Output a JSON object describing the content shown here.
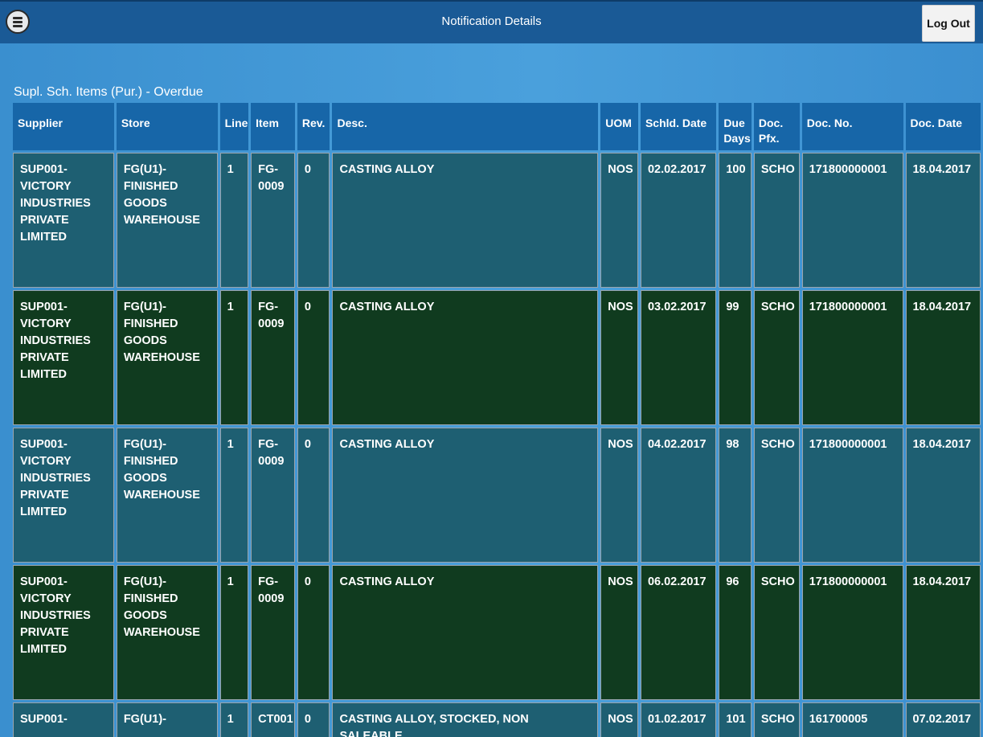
{
  "header": {
    "title": "Notification Details",
    "logout_label": "Log Out",
    "menu_icon": "menu-icon"
  },
  "section": {
    "title": "Supl. Sch. Items (Pur.) - Overdue"
  },
  "table": {
    "columns": [
      "Supplier",
      "Store",
      "Line",
      "Item",
      "Rev.",
      "Desc.",
      "UOM",
      "Schld. Date",
      "Due Days",
      "Doc. Pfx.",
      "Doc. No.",
      "Doc. Date"
    ],
    "rows": [
      [
        "SUP001-VICTORY INDUSTRIES PRIVATE LIMITED",
        "FG(U1)-FINISHED GOODS WAREHOUSE",
        "1",
        "FG-0009",
        "0",
        "CASTING ALLOY",
        "NOS",
        "02.02.2017",
        "100",
        "SCHO",
        "171800000001",
        "18.04.2017"
      ],
      [
        "SUP001-VICTORY INDUSTRIES PRIVATE LIMITED",
        "FG(U1)-FINISHED GOODS WAREHOUSE",
        "1",
        "FG-0009",
        "0",
        "CASTING ALLOY",
        "NOS",
        "03.02.2017",
        "99",
        "SCHO",
        "171800000001",
        "18.04.2017"
      ],
      [
        "SUP001-VICTORY INDUSTRIES PRIVATE LIMITED",
        "FG(U1)-FINISHED GOODS WAREHOUSE",
        "1",
        "FG-0009",
        "0",
        "CASTING ALLOY",
        "NOS",
        "04.02.2017",
        "98",
        "SCHO",
        "171800000001",
        "18.04.2017"
      ],
      [
        "SUP001-VICTORY INDUSTRIES PRIVATE LIMITED",
        "FG(U1)-FINISHED GOODS WAREHOUSE",
        "1",
        "FG-0009",
        "0",
        "CASTING ALLOY",
        "NOS",
        "06.02.2017",
        "96",
        "SCHO",
        "171800000001",
        "18.04.2017"
      ],
      [
        "SUP001-",
        "FG(U1)-",
        "1",
        "CT001",
        "0",
        "CASTING ALLOY, STOCKED, NON SALEABLE",
        "NOS",
        "01.02.2017",
        "101",
        "SCHO",
        "161700005",
        "07.02.2017"
      ]
    ]
  },
  "colors": {
    "header_bar": "#1a5a96",
    "table_header": "#1766a8",
    "row_teal": "#1e5f72",
    "row_green": "#103b1f"
  }
}
